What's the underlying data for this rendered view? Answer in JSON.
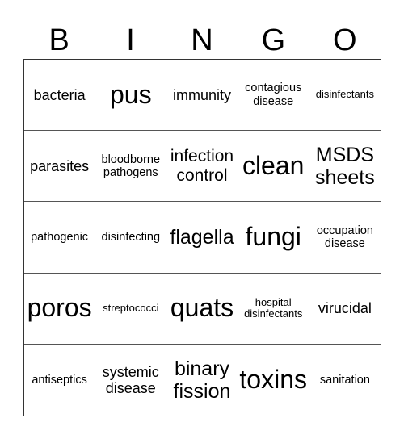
{
  "header": [
    "B",
    "I",
    "N",
    "G",
    "O"
  ],
  "cells": [
    {
      "text": "bacteria",
      "size": "s-md"
    },
    {
      "text": "pus",
      "size": "s-xxl"
    },
    {
      "text": "immunity",
      "size": "s-md"
    },
    {
      "text": "contagious disease",
      "size": "s-sm"
    },
    {
      "text": "disinfectants",
      "size": "s-xs"
    },
    {
      "text": "parasites",
      "size": "s-md"
    },
    {
      "text": "bloodborne pathogens",
      "size": "s-sm"
    },
    {
      "text": "infection control",
      "size": "s-lg"
    },
    {
      "text": "clean",
      "size": "s-xxl"
    },
    {
      "text": "MSDS sheets",
      "size": "s-xl"
    },
    {
      "text": "pathogenic",
      "size": "s-sm"
    },
    {
      "text": "disinfecting",
      "size": "s-sm"
    },
    {
      "text": "flagella",
      "size": "s-xl"
    },
    {
      "text": "fungi",
      "size": "s-xxl"
    },
    {
      "text": "occupation disease",
      "size": "s-sm"
    },
    {
      "text": "poros",
      "size": "s-xxl"
    },
    {
      "text": "streptococci",
      "size": "s-xs"
    },
    {
      "text": "quats",
      "size": "s-xxl"
    },
    {
      "text": "hospital disinfectants",
      "size": "s-xs"
    },
    {
      "text": "virucidal",
      "size": "s-md"
    },
    {
      "text": "antiseptics",
      "size": "s-sm"
    },
    {
      "text": "systemic disease",
      "size": "s-md"
    },
    {
      "text": "binary fission",
      "size": "s-xl"
    },
    {
      "text": "toxins",
      "size": "s-xxl"
    },
    {
      "text": "sanitation",
      "size": "s-sm"
    }
  ]
}
